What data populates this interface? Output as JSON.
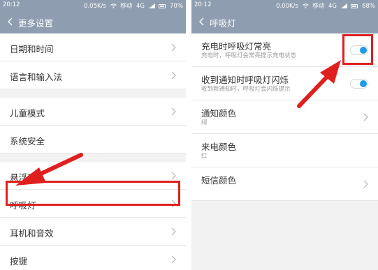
{
  "left": {
    "status": {
      "time": "20:12",
      "network_speed": "0.05K/s",
      "carrier": "移动",
      "net_type": "4G",
      "battery": "70%"
    },
    "nav": {
      "title": "更多设置"
    },
    "rows": [
      {
        "label": "日期和时间"
      },
      {
        "label": "语言和输入法"
      },
      {
        "label": "儿童模式"
      },
      {
        "label": "系统安全"
      },
      {
        "label": "悬浮球"
      },
      {
        "label": "呼吸灯"
      },
      {
        "label": "耳机和音效"
      },
      {
        "label": "按键"
      }
    ]
  },
  "right": {
    "status": {
      "time": "20:12",
      "network_speed": "0.00K/s",
      "carrier": "移动",
      "net_type": "4G",
      "battery": "68%"
    },
    "nav": {
      "title": "呼吸灯"
    },
    "toggles": [
      {
        "label": "充电时呼吸灯常亮",
        "sub": "充电时，呼吸灯会常亮提示充电状态",
        "on": true
      },
      {
        "label": "收到通知时呼吸灯闪烁",
        "sub": "收到新通知时，呼吸灯会闪烁提示",
        "on": true
      }
    ],
    "colors": [
      {
        "label": "通知颜色",
        "value": "绿"
      },
      {
        "label": "来电颜色",
        "value": "红"
      },
      {
        "label": "短信颜色",
        "value": ""
      }
    ]
  },
  "theme": {
    "header": "#8e9eb0",
    "toggle_on": "#1a9bef",
    "annotation": "#e01f1f"
  }
}
